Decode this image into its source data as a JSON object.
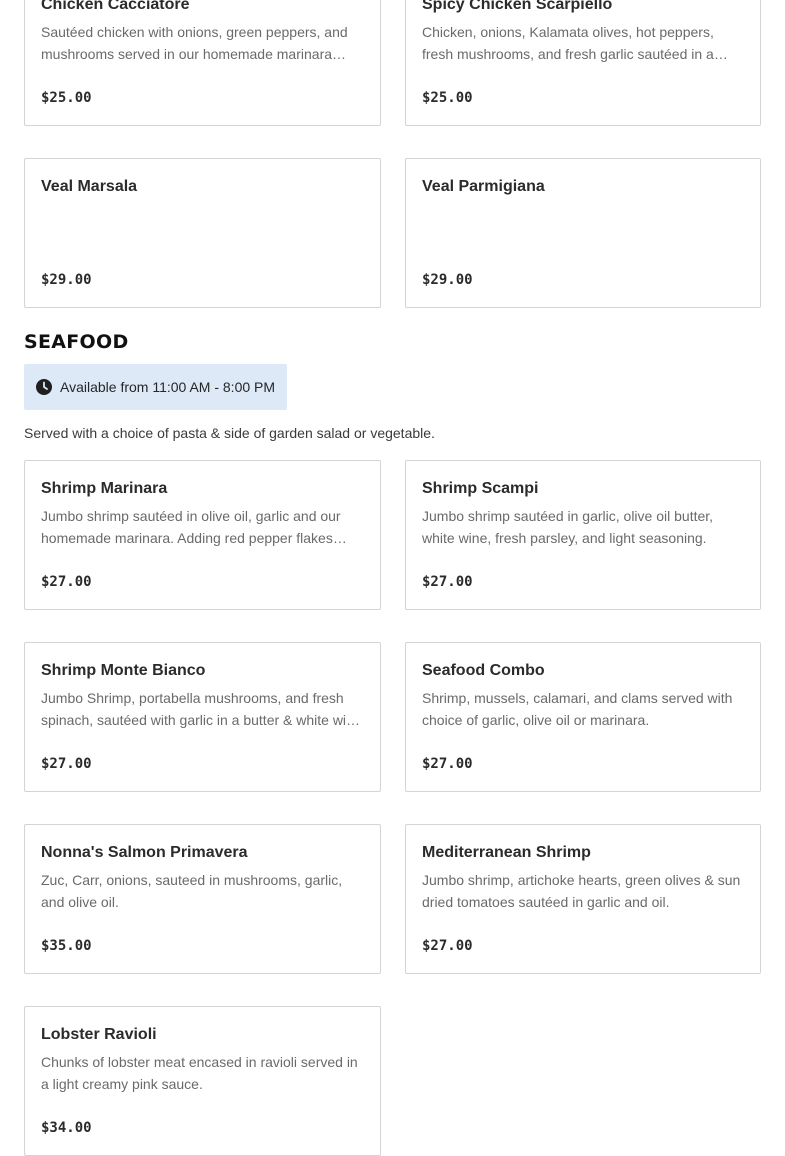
{
  "top_items": [
    {
      "name": "Chicken Cacciatore",
      "description": "Sautéed chicken with onions, green peppers, and mushrooms served in our homemade marinara sauce.",
      "price": "$25.00"
    },
    {
      "name": "Spicy Chicken Scarpiello",
      "description": "Chicken, onions, Kalamata olives, hot peppers, fresh mushrooms, and fresh garlic sautéed in a spicy sauce.",
      "price": "$25.00"
    },
    {
      "name": "Veal Marsala",
      "description": "",
      "price": "$29.00"
    },
    {
      "name": "Veal Parmigiana",
      "description": "",
      "price": "$29.00"
    }
  ],
  "seafood": {
    "heading": "SEAFOOD",
    "availability": "Available from 11:00 AM - 8:00 PM",
    "note": "Served with a choice of pasta & side of garden salad or vegetable.",
    "items": [
      {
        "name": "Shrimp Marinara",
        "description": "Jumbo shrimp sautéed in olive oil, garlic and our homemade marinara. Adding red pepper flakes upon request.",
        "price": "$27.00"
      },
      {
        "name": "Shrimp Scampi",
        "description": "Jumbo shrimp sautéed in garlic, olive oil butter, white wine, fresh parsley, and light seasoning.",
        "price": "$27.00"
      },
      {
        "name": "Shrimp Monte Bianco",
        "description": "Jumbo Shrimp, portabella mushrooms, and fresh spinach, sautéed with garlic in a butter & white wine sauce.",
        "price": "$27.00"
      },
      {
        "name": "Seafood Combo",
        "description": "Shrimp, mussels, calamari, and clams served with choice of garlic, olive oil or marinara.",
        "price": "$27.00"
      },
      {
        "name": "Nonna's Salmon Primavera",
        "description": "Zuc, Carr, onions, sauteed in mushrooms, garlic, and olive oil.",
        "price": "$35.00"
      },
      {
        "name": "Mediterranean Shrimp",
        "description": "Jumbo shrimp, artichoke hearts, green olives & sun dried tomatoes sautéed in garlic and oil.",
        "price": "$27.00"
      },
      {
        "name": "Lobster Ravioli",
        "description": "Chunks of lobster meat encased in ravioli served in a light creamy pink sauce.",
        "price": "$34.00"
      }
    ]
  },
  "icons": {
    "clock": "clock-icon"
  },
  "colors": {
    "availability_background": "#dde9f7",
    "card_border": "#d4d4d4",
    "description_text": "#6a6a6a"
  }
}
